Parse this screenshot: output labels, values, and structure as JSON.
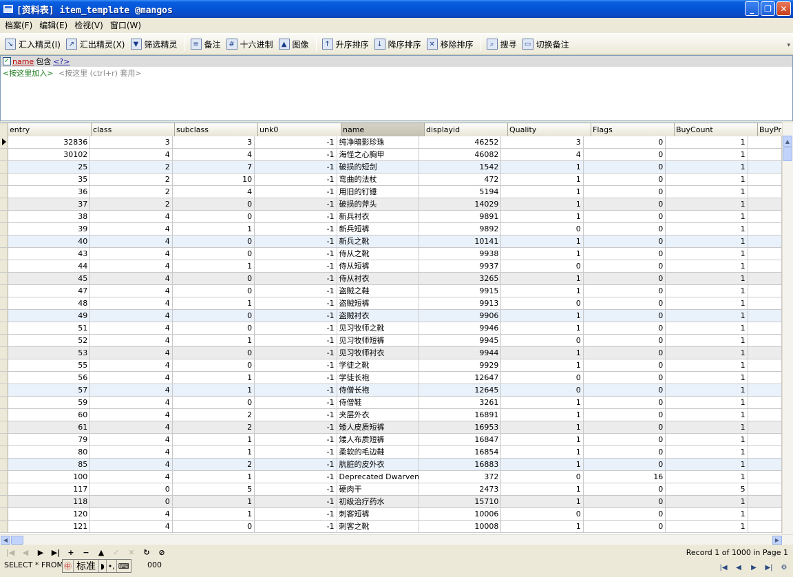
{
  "window": {
    "title": "[资料表] item_template @mangos",
    "minimize": "_",
    "restore": "❐",
    "close": "✕"
  },
  "menu": {
    "items": [
      "档案(F)",
      "编辑(E)",
      "检视(V)",
      "窗口(W)"
    ]
  },
  "toolbar": {
    "buttons": [
      {
        "label": "汇入精灵(I)",
        "icon": "import-icon"
      },
      {
        "label": "汇出精灵(X)",
        "icon": "export-icon"
      },
      {
        "label": "筛选精灵",
        "icon": "filter-wizard-icon"
      },
      {
        "label": "备注",
        "icon": "memo-icon"
      },
      {
        "label": "十六进制",
        "icon": "hex-icon"
      },
      {
        "label": "图像",
        "icon": "image-icon"
      },
      {
        "label": "升序排序",
        "icon": "sort-asc-icon"
      },
      {
        "label": "降序排序",
        "icon": "sort-desc-icon"
      },
      {
        "label": "移除排序",
        "icon": "remove-sort-icon"
      },
      {
        "label": "搜寻",
        "icon": "search-icon"
      },
      {
        "label": "切换备注",
        "icon": "toggle-memo-icon"
      }
    ]
  },
  "filter": {
    "field": "name",
    "operator": "包含",
    "value": "<?>",
    "add_text": "<按这里加入>",
    "apply_text": "<按这里 (ctrl+r) 套用>"
  },
  "grid": {
    "columns": [
      "entry",
      "class",
      "subclass",
      "unk0",
      "name",
      "displayid",
      "Quality",
      "Flags",
      "BuyCount",
      "BuyPri"
    ],
    "rows": [
      [
        "32836",
        "3",
        "3",
        "-1",
        "纯净暗影珍珠",
        "46252",
        "3",
        "0",
        "1"
      ],
      [
        "30102",
        "4",
        "4",
        "-1",
        "海怪之心胸甲",
        "46082",
        "4",
        "0",
        "1"
      ],
      [
        "25",
        "2",
        "7",
        "-1",
        "破损的短剑",
        "1542",
        "1",
        "0",
        "1"
      ],
      [
        "35",
        "2",
        "10",
        "-1",
        "弯曲的法杖",
        "472",
        "1",
        "0",
        "1"
      ],
      [
        "36",
        "2",
        "4",
        "-1",
        "用旧的钉锤",
        "5194",
        "1",
        "0",
        "1"
      ],
      [
        "37",
        "2",
        "0",
        "-1",
        "破损的斧头",
        "14029",
        "1",
        "0",
        "1"
      ],
      [
        "38",
        "4",
        "0",
        "-1",
        "新兵衬衣",
        "9891",
        "1",
        "0",
        "1"
      ],
      [
        "39",
        "4",
        "1",
        "-1",
        "新兵短裤",
        "9892",
        "0",
        "0",
        "1"
      ],
      [
        "40",
        "4",
        "0",
        "-1",
        "新兵之靴",
        "10141",
        "1",
        "0",
        "1"
      ],
      [
        "43",
        "4",
        "0",
        "-1",
        "侍从之靴",
        "9938",
        "1",
        "0",
        "1"
      ],
      [
        "44",
        "4",
        "1",
        "-1",
        "侍从短裤",
        "9937",
        "0",
        "0",
        "1"
      ],
      [
        "45",
        "4",
        "0",
        "-1",
        "侍从衬衣",
        "3265",
        "1",
        "0",
        "1"
      ],
      [
        "47",
        "4",
        "0",
        "-1",
        "盗贼之鞋",
        "9915",
        "1",
        "0",
        "1"
      ],
      [
        "48",
        "4",
        "1",
        "-1",
        "盗贼短裤",
        "9913",
        "0",
        "0",
        "1"
      ],
      [
        "49",
        "4",
        "0",
        "-1",
        "盗贼衬衣",
        "9906",
        "1",
        "0",
        "1"
      ],
      [
        "51",
        "4",
        "0",
        "-1",
        "见习牧师之靴",
        "9946",
        "1",
        "0",
        "1"
      ],
      [
        "52",
        "4",
        "1",
        "-1",
        "见习牧师短裤",
        "9945",
        "0",
        "0",
        "1"
      ],
      [
        "53",
        "4",
        "0",
        "-1",
        "见习牧师衬衣",
        "9944",
        "1",
        "0",
        "1"
      ],
      [
        "55",
        "4",
        "0",
        "-1",
        "学徒之靴",
        "9929",
        "1",
        "0",
        "1"
      ],
      [
        "56",
        "4",
        "1",
        "-1",
        "学徒长袍",
        "12647",
        "0",
        "0",
        "1"
      ],
      [
        "57",
        "4",
        "1",
        "-1",
        "侍僧长袍",
        "12645",
        "0",
        "0",
        "1"
      ],
      [
        "59",
        "4",
        "0",
        "-1",
        "侍僧鞋",
        "3261",
        "1",
        "0",
        "1"
      ],
      [
        "60",
        "4",
        "2",
        "-1",
        "夹层外衣",
        "16891",
        "1",
        "0",
        "1"
      ],
      [
        "61",
        "4",
        "2",
        "-1",
        "矮人皮质短裤",
        "16953",
        "1",
        "0",
        "1"
      ],
      [
        "79",
        "4",
        "1",
        "-1",
        "矮人布质短裤",
        "16847",
        "1",
        "0",
        "1"
      ],
      [
        "80",
        "4",
        "1",
        "-1",
        "柔软的毛边鞋",
        "16854",
        "1",
        "0",
        "1"
      ],
      [
        "85",
        "4",
        "2",
        "-1",
        "肮脏的皮外衣",
        "16883",
        "1",
        "0",
        "1"
      ],
      [
        "100",
        "4",
        "1",
        "-1",
        "Deprecated Dwarven Sq",
        "372",
        "0",
        "16",
        "1"
      ],
      [
        "117",
        "0",
        "5",
        "-1",
        "硬肉干",
        "2473",
        "1",
        "0",
        "5"
      ],
      [
        "118",
        "0",
        "1",
        "-1",
        "初级治疗药水",
        "15710",
        "1",
        "0",
        "1"
      ],
      [
        "120",
        "4",
        "1",
        "-1",
        "刺客短裤",
        "10006",
        "0",
        "0",
        "1"
      ],
      [
        "121",
        "4",
        "0",
        "-1",
        "刺客之靴",
        "10008",
        "1",
        "0",
        "1"
      ]
    ]
  },
  "navigator": {
    "record_info": "Record 1 of 1000 in Page 1"
  },
  "status": {
    "sql": "SELECT * FROM",
    "ime_mode": "标准",
    "count": "000"
  }
}
